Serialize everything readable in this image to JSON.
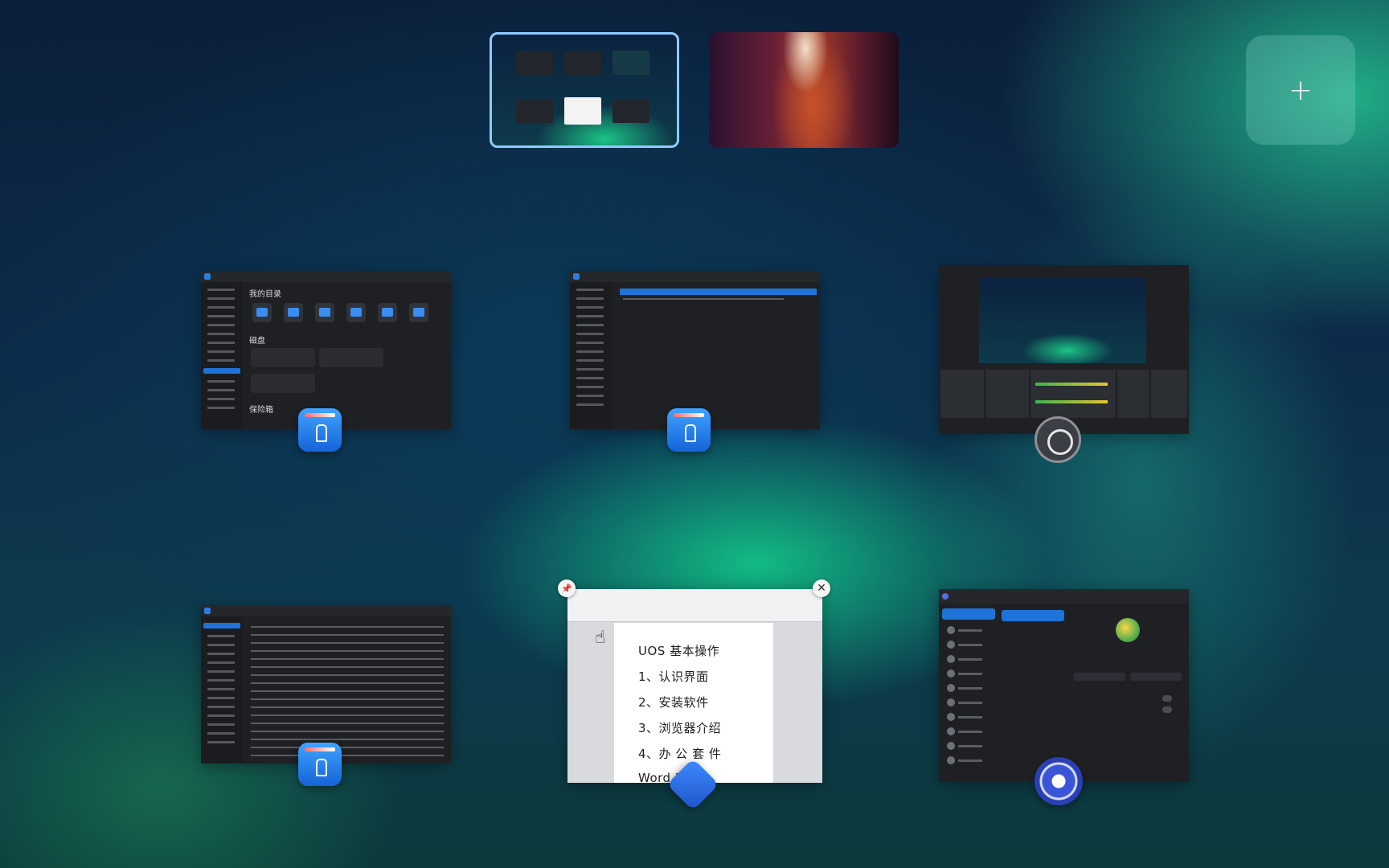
{
  "workspaces": {
    "items": [
      {
        "name": "workspace-1",
        "active": true
      },
      {
        "name": "workspace-2",
        "active": false
      }
    ],
    "add_label": "+"
  },
  "windows": {
    "file_manager_1": {
      "heading_my_dirs": "我的目录",
      "heading_disks": "磁盘",
      "heading_vault": "保险箱"
    },
    "document": {
      "lines": [
        "UOS 基本操作",
        "1、认识界面",
        "2、安装软件",
        "3、浏览器介绍",
        "4、办 公 套 件",
        "Word PPT"
      ]
    },
    "icons": {
      "fm": "file-manager-icon",
      "obs": "obs-icon",
      "wps": "wps-writer-icon",
      "settings": "control-center-icon"
    },
    "controls": {
      "pin_label": "📌",
      "close_label": "✕"
    }
  }
}
